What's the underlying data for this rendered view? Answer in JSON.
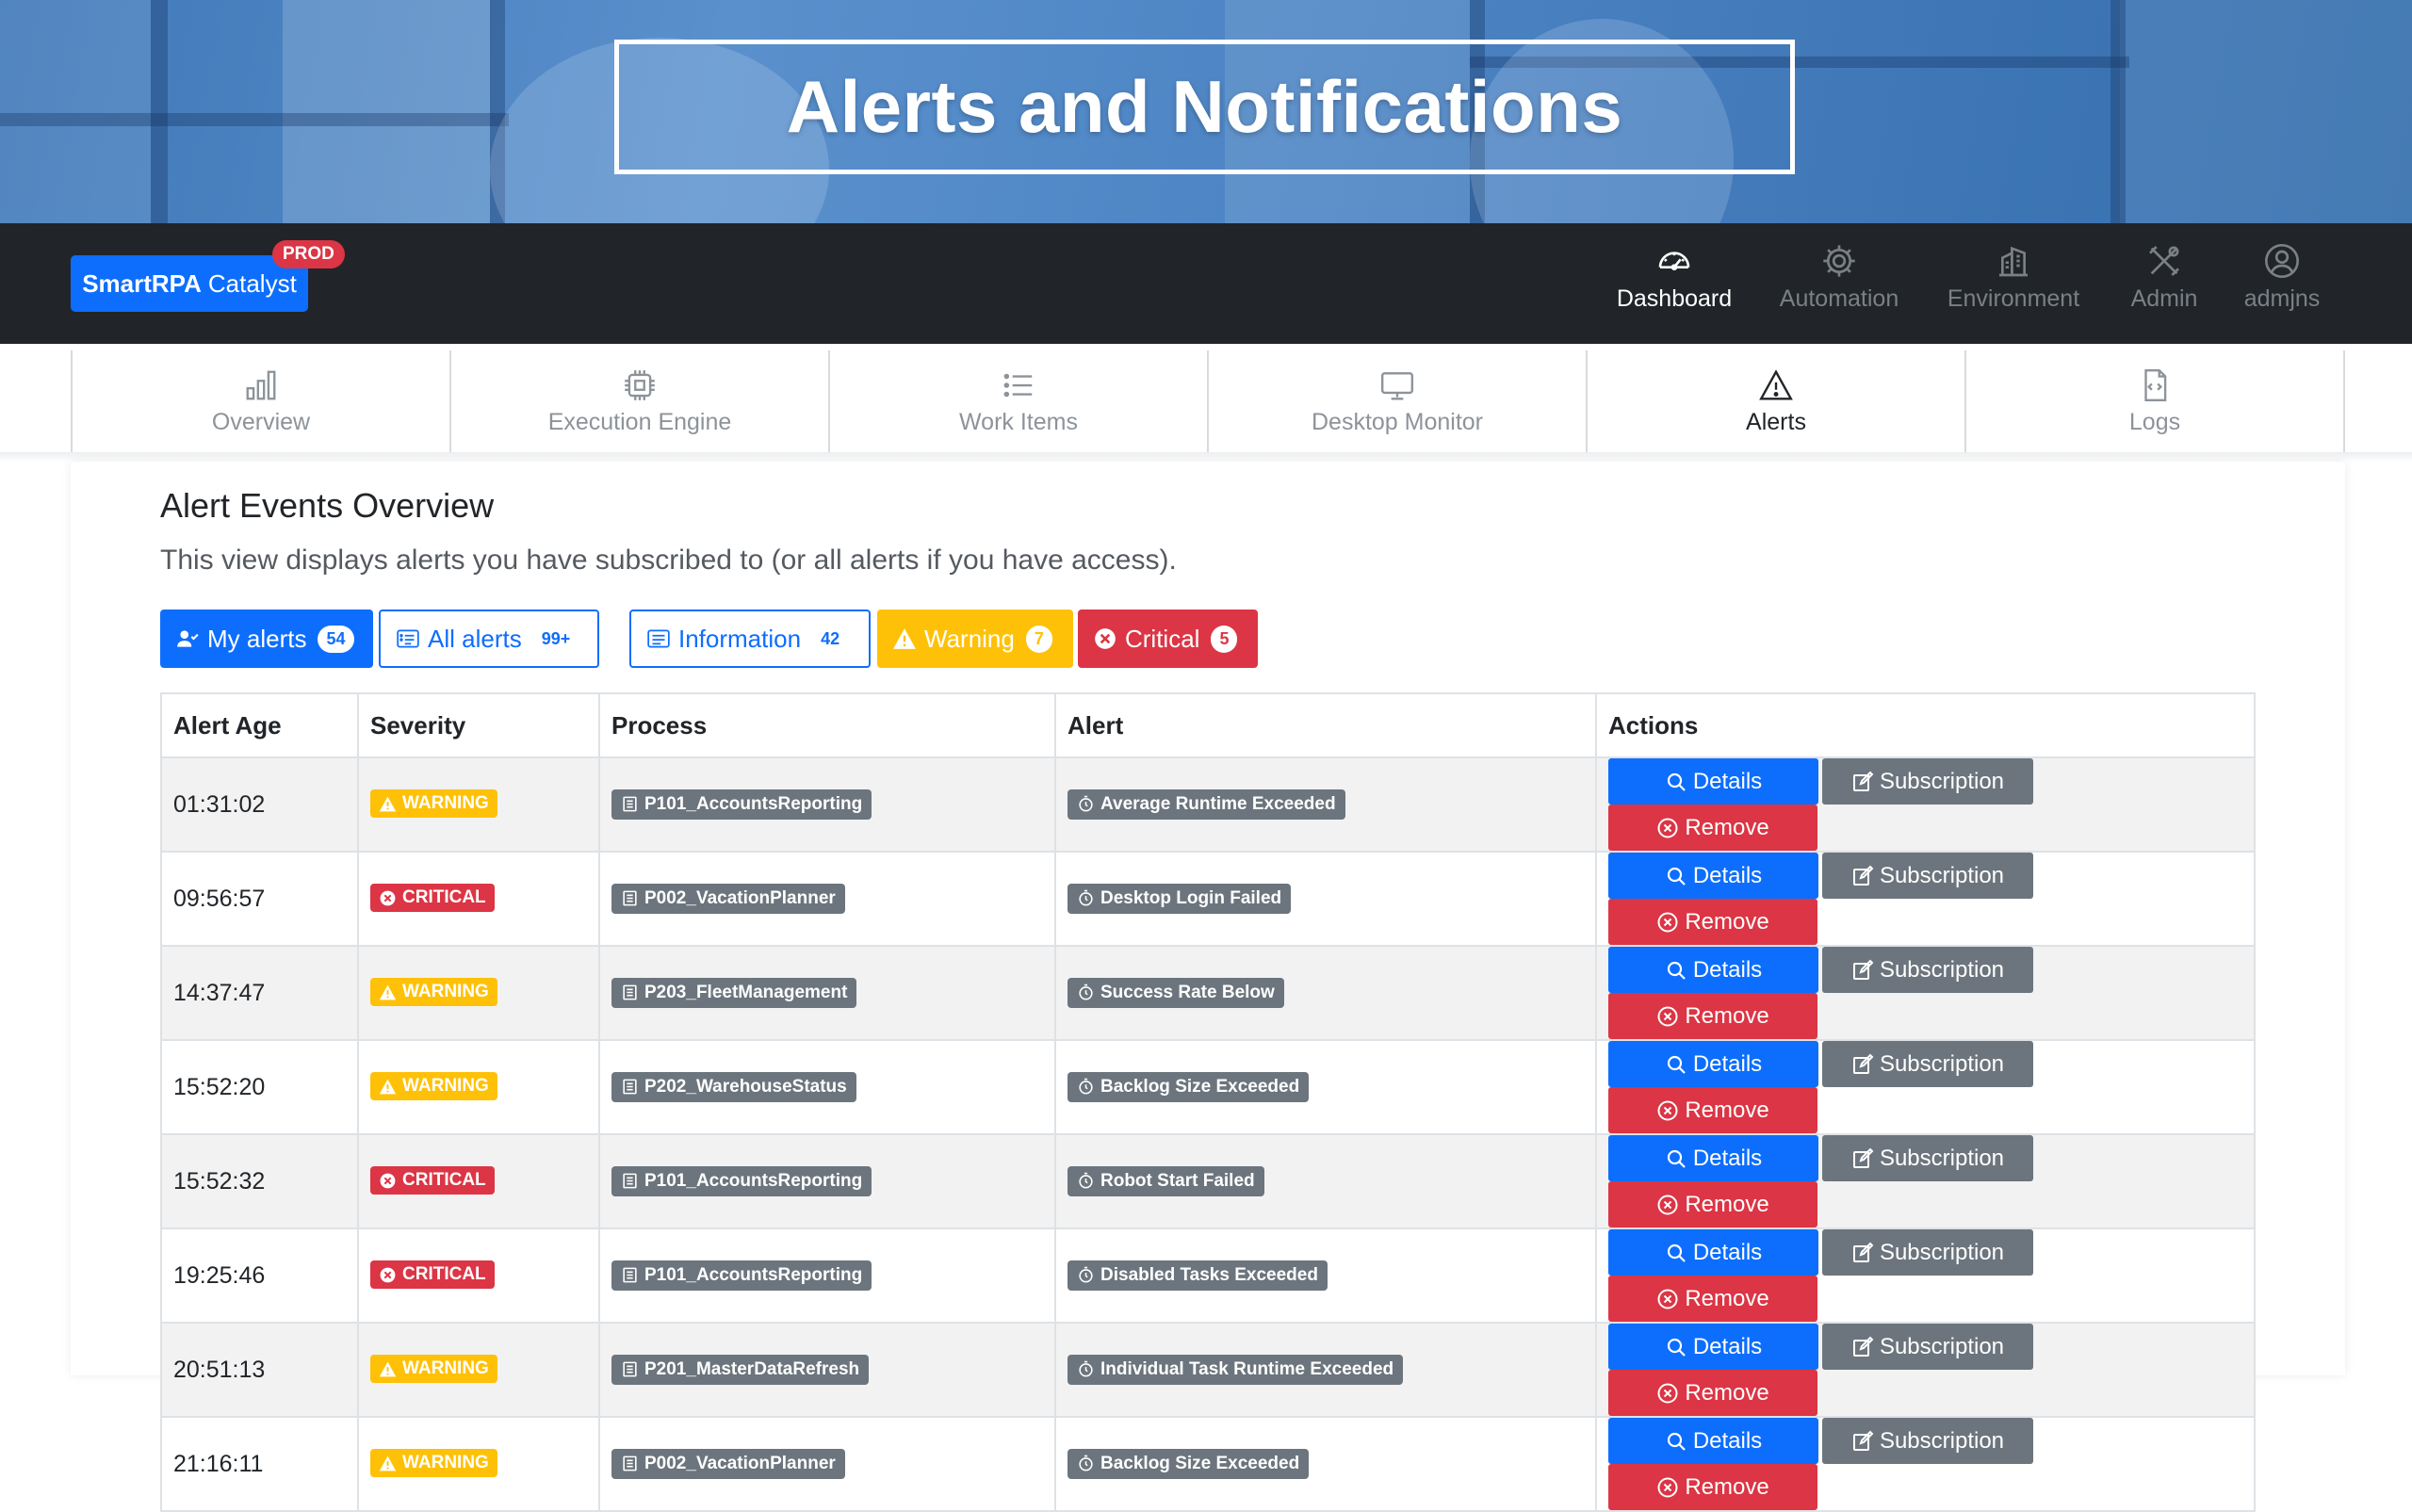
{
  "banner": {
    "title": "Alerts and Notifications"
  },
  "navbar": {
    "brand_bold": "SmartRPA",
    "brand_rest": "Catalyst",
    "env_badge": "PROD",
    "items": [
      {
        "label": "Dashboard",
        "icon": "speedometer-icon",
        "active": true
      },
      {
        "label": "Automation",
        "icon": "gear-icon",
        "active": false
      },
      {
        "label": "Environment",
        "icon": "building-icon",
        "active": false
      },
      {
        "label": "Admin",
        "icon": "tools-icon",
        "active": false
      },
      {
        "label": "admjns",
        "icon": "user-circle-icon",
        "active": false
      }
    ]
  },
  "subnav": {
    "tabs": [
      {
        "label": "Overview",
        "icon": "bar-chart-icon",
        "active": false
      },
      {
        "label": "Execution Engine",
        "icon": "cpu-icon",
        "active": false
      },
      {
        "label": "Work Items",
        "icon": "list-icon",
        "active": false
      },
      {
        "label": "Desktop Monitor",
        "icon": "display-icon",
        "active": false
      },
      {
        "label": "Alerts",
        "icon": "warning-triangle-icon",
        "active": true
      },
      {
        "label": "Logs",
        "icon": "file-code-icon",
        "active": false
      }
    ]
  },
  "overview": {
    "title": "Alert Events Overview",
    "description": "This view displays alerts you have subscribed to (or all alerts if you have access)."
  },
  "filters": {
    "my_alerts": {
      "label": "My alerts",
      "count": "54"
    },
    "all_alerts": {
      "label": "All alerts",
      "count": "99+"
    },
    "information": {
      "label": "Information",
      "count": "42"
    },
    "warning": {
      "label": "Warning",
      "count": "7"
    },
    "critical": {
      "label": "Critical",
      "count": "5"
    }
  },
  "table": {
    "headers": {
      "age": "Alert Age",
      "severity": "Severity",
      "process": "Process",
      "alert": "Alert",
      "actions": "Actions"
    },
    "action_labels": {
      "details": "Details",
      "subscription": "Subscription",
      "remove": "Remove"
    },
    "rows": [
      {
        "age": "01:31:02",
        "severity": "WARNING",
        "process": "P101_AccountsReporting",
        "alert": "Average Runtime Exceeded"
      },
      {
        "age": "09:56:57",
        "severity": "CRITICAL",
        "process": "P002_VacationPlanner",
        "alert": "Desktop Login Failed"
      },
      {
        "age": "14:37:47",
        "severity": "WARNING",
        "process": "P203_FleetManagement",
        "alert": "Success Rate Below"
      },
      {
        "age": "15:52:20",
        "severity": "WARNING",
        "process": "P202_WarehouseStatus",
        "alert": "Backlog Size Exceeded"
      },
      {
        "age": "15:52:32",
        "severity": "CRITICAL",
        "process": "P101_AccountsReporting",
        "alert": "Robot Start Failed"
      },
      {
        "age": "19:25:46",
        "severity": "CRITICAL",
        "process": "P101_AccountsReporting",
        "alert": "Disabled Tasks Exceeded"
      },
      {
        "age": "20:51:13",
        "severity": "WARNING",
        "process": "P201_MasterDataRefresh",
        "alert": "Individual Task Runtime Exceeded"
      },
      {
        "age": "21:16:11",
        "severity": "WARNING",
        "process": "P002_VacationPlanner",
        "alert": "Backlog Size Exceeded"
      }
    ]
  },
  "colors": {
    "primary": "#0d6efd",
    "secondary": "#6c757d",
    "warning": "#ffc107",
    "danger": "#dc3545",
    "navbar": "#212529"
  }
}
